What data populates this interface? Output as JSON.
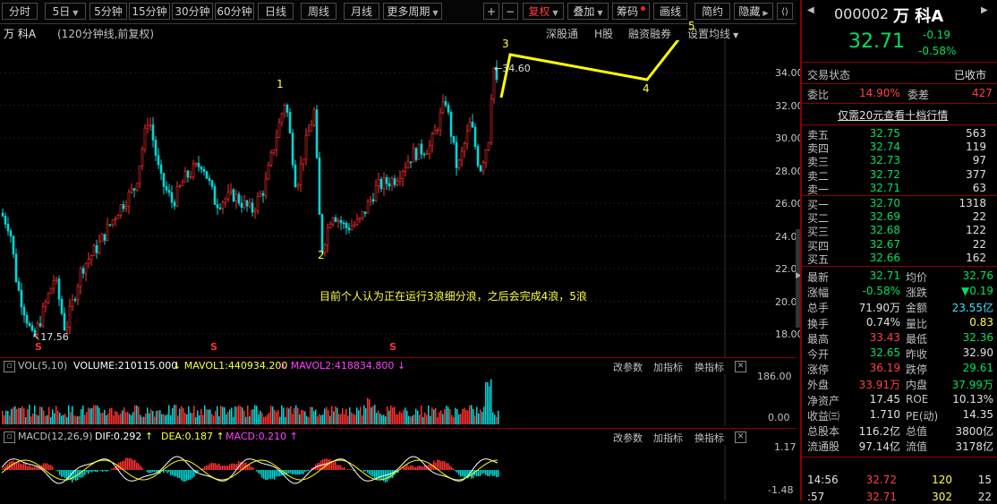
{
  "toolbar": {
    "periods": [
      "分时",
      "5日",
      "5分钟",
      "15分钟",
      "30分钟",
      "60分钟",
      "日线",
      "周线",
      "月线",
      "更多周期"
    ],
    "plus": "+",
    "minus": "−",
    "fuquan": "复权",
    "diejia": "叠加",
    "chouma": "筹码",
    "huaxian": "画线",
    "jianyue": "简约",
    "yincang": "隐藏"
  },
  "chart": {
    "stock_name": "万  科A",
    "desc": "(120分钟线,前复权)",
    "links": [
      "深股通",
      "H股",
      "融资融券",
      "设置均线"
    ],
    "y_ticks": [
      "34.00",
      "32.00",
      "30.00",
      "28.00",
      "26.00",
      "24.00",
      "22.00",
      "20.00",
      "18.00"
    ],
    "high_label": "34.60",
    "low_label": "17.56",
    "wave_labels": [
      "1",
      "2",
      "3",
      "4",
      "5"
    ],
    "annotation": "目前个人认为正在运行3浪细分浪，之后会完成4浪，5浪",
    "s_marks": [
      "S",
      "S",
      "S"
    ],
    "colors": {
      "up": "#ff3030",
      "down": "#00d8d8",
      "wave": "#ffff00"
    }
  },
  "volume": {
    "label": "VOL(5,10)",
    "volume": "VOLUME:210115.000",
    "mavol1": "MAVOL1:440934.200",
    "mavol2": "MAVOL2:418834.800",
    "y_top": "186.00",
    "y_bottom": "0.00",
    "actions": [
      "改参数",
      "加指标",
      "换指标"
    ]
  },
  "macd": {
    "label": "MACD(12,26,9)",
    "dif": "DIF:0.292",
    "dea": "DEA:0.187",
    "macd": "MACD:0.210",
    "y_top": "1.17",
    "y_bottom": "-1.48",
    "actions": [
      "改参数",
      "加指标",
      "换指标"
    ]
  },
  "quote": {
    "code": "000002",
    "name": "万  科A",
    "price": "32.71",
    "change": "-0.19",
    "change_pct": "-0.58%",
    "trade_status_label": "交易状态",
    "trade_status": "已收市",
    "weibi_label": "委比",
    "weibi": "14.90%",
    "weicha_label": "委差",
    "weicha": "427",
    "promo": "仅需20元查看十档行情",
    "sell": [
      {
        "label": "卖五",
        "price": "32.75",
        "vol": "563"
      },
      {
        "label": "卖四",
        "price": "32.74",
        "vol": "119"
      },
      {
        "label": "卖三",
        "price": "32.73",
        "vol": "97"
      },
      {
        "label": "卖二",
        "price": "32.72",
        "vol": "377"
      },
      {
        "label": "卖一",
        "price": "32.71",
        "vol": "63"
      }
    ],
    "buy": [
      {
        "label": "买一",
        "price": "32.70",
        "vol": "1318"
      },
      {
        "label": "买二",
        "price": "32.69",
        "vol": "22"
      },
      {
        "label": "买三",
        "price": "32.68",
        "vol": "122"
      },
      {
        "label": "买四",
        "price": "32.67",
        "vol": "22"
      },
      {
        "label": "买五",
        "price": "32.66",
        "vol": "162"
      }
    ],
    "stats": [
      {
        "l1": "最新",
        "v1": "32.71",
        "c1": "green",
        "l2": "均价",
        "v2": "32.76",
        "c2": "green"
      },
      {
        "l1": "涨幅",
        "v1": "-0.58%",
        "c1": "green",
        "l2": "涨跌",
        "v2": "▼0.19",
        "c2": "green"
      },
      {
        "l1": "总手",
        "v1": "71.90万",
        "c1": "white",
        "l2": "金额",
        "v2": "23.55亿",
        "c2": "cyan"
      },
      {
        "l1": "换手",
        "v1": "0.74%",
        "c1": "white",
        "l2": "量比",
        "v2": "0.83",
        "c2": "yellow"
      },
      {
        "l1": "最高",
        "v1": "33.43",
        "c1": "red",
        "l2": "最低",
        "v2": "32.36",
        "c2": "green"
      },
      {
        "l1": "今开",
        "v1": "32.65",
        "c1": "green",
        "l2": "昨收",
        "v2": "32.90",
        "c2": "white"
      },
      {
        "l1": "涨停",
        "v1": "36.19",
        "c1": "red",
        "l2": "跌停",
        "v2": "29.61",
        "c2": "green"
      },
      {
        "l1": "外盘",
        "v1": "33.91万",
        "c1": "red",
        "l2": "内盘",
        "v2": "37.99万",
        "c2": "green"
      },
      {
        "l1": "净资产",
        "v1": "17.45",
        "c1": "white",
        "l2": "ROE",
        "v2": "10.13%",
        "c2": "white"
      },
      {
        "l1": "收益㈢",
        "v1": "1.710",
        "c1": "white",
        "l2": "PE(动)",
        "v2": "14.35",
        "c2": "white"
      },
      {
        "l1": "总股本",
        "v1": "116.2亿",
        "c1": "white",
        "l2": "总值",
        "v2": "3800亿",
        "c2": "white"
      },
      {
        "l1": "流通股",
        "v1": "97.14亿",
        "c1": "white",
        "l2": "流值",
        "v2": "3178亿",
        "c2": "white"
      }
    ],
    "ticks": [
      {
        "time": "14:56",
        "price": "32.72",
        "vol": "120",
        "num": "15"
      },
      {
        "time": ":57",
        "price": "32.71",
        "vol": "302",
        "num": "22"
      }
    ]
  }
}
